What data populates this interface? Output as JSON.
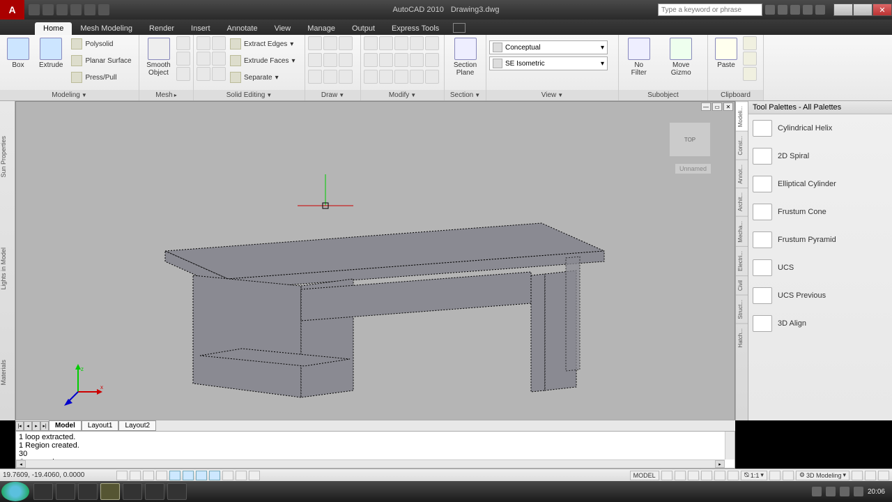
{
  "titlebar": {
    "app": "AutoCAD 2010",
    "doc": "Drawing3.dwg",
    "search_placeholder": "Type a keyword or phrase"
  },
  "tabs": [
    "Home",
    "Mesh Modeling",
    "Render",
    "Insert",
    "Annotate",
    "View",
    "Manage",
    "Output",
    "Express Tools"
  ],
  "active_tab": "Home",
  "ribbon": {
    "modeling": {
      "title": "Modeling",
      "box": "Box",
      "extrude": "Extrude",
      "polysolid": "Polysolid",
      "planar": "Planar Surface",
      "presspull": "Press/Pull"
    },
    "mesh": {
      "title": "Mesh",
      "smooth": "Smooth Object"
    },
    "solid_editing": {
      "title": "Solid Editing",
      "extract": "Extract Edges",
      "extrude_faces": "Extrude Faces",
      "separate": "Separate"
    },
    "draw": {
      "title": "Draw"
    },
    "modify": {
      "title": "Modify"
    },
    "section": {
      "title": "Section",
      "plane": "Section Plane"
    },
    "view": {
      "title": "View",
      "visual_style": "Conceptual",
      "view_dir": "SE Isometric"
    },
    "subobject": {
      "title": "Subobject",
      "nofilter": "No Filter",
      "gizmo": "Move Gizmo"
    },
    "clipboard": {
      "title": "Clipboard",
      "paste": "Paste"
    }
  },
  "left_rail": [
    "Sun Properties",
    "Lights in Model",
    "Materials"
  ],
  "viewcube_label": "Unnamed",
  "viewcube_face": "TOP",
  "palette": {
    "title": "Tool Palettes - All Palettes",
    "rail": [
      "Modeli...",
      "Const...",
      "Annot...",
      "Archit...",
      "Mecha...",
      "Electri...",
      "Civil",
      "Struct...",
      "Hatch..."
    ],
    "items": [
      "Cylindrical Helix",
      "2D Spiral",
      "Elliptical Cylinder",
      "Frustum Cone",
      "Frustum Pyramid",
      "UCS",
      "UCS Previous",
      "3D Align"
    ]
  },
  "layout_tabs": [
    "Model",
    "Layout1",
    "Layout2"
  ],
  "command_lines": [
    "1 loop extracted.",
    "1 Region created.",
    "30",
    "Command:"
  ],
  "status": {
    "coords": "19.7609, -19.4060, 0.0000",
    "model": "MODEL",
    "scale": "1:1",
    "workspace": "3D Modeling"
  },
  "clock": "20:06"
}
